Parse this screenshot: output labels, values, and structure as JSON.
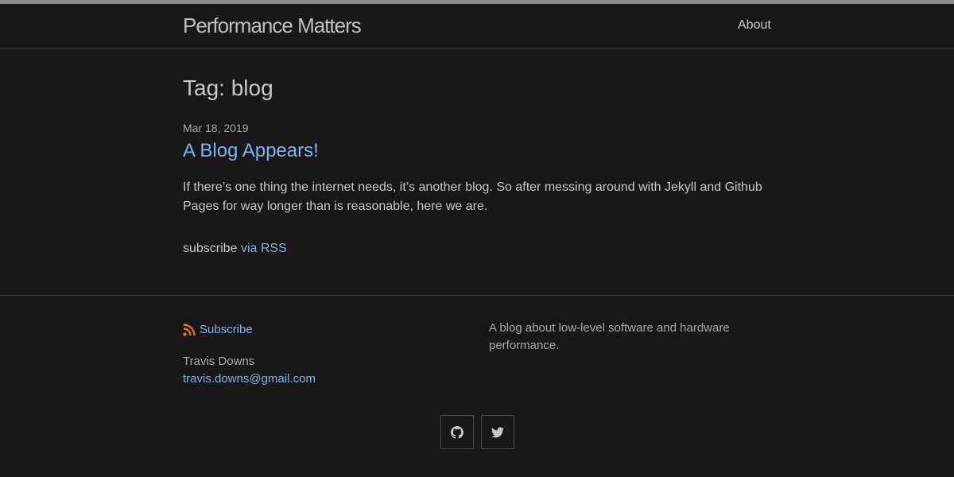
{
  "header": {
    "site_title": "Performance Matters",
    "nav": {
      "about_label": "About"
    }
  },
  "main": {
    "page_heading": "Tag: blog",
    "posts": [
      {
        "date": "Mar 18, 2019",
        "title": "A Blog Appears!",
        "excerpt": "If there’s one thing the internet needs, it’s another blog. So after messing around with Jekyll and Github Pages for way longer than is reasonable, here we are."
      }
    ],
    "rss": {
      "prefix": "subscribe",
      "link_label": "via RSS"
    }
  },
  "footer": {
    "subscribe_label": "Subscribe",
    "author_name": "Travis Downs",
    "author_email": "travis.downs@gmail.com",
    "description": "A blog about low-level software and hardware performance.",
    "social": [
      {
        "icon": "github-icon"
      },
      {
        "icon": "twitter-icon"
      }
    ]
  },
  "colors": {
    "background": "#181818",
    "text": "#c8c8c8",
    "muted_text": "#a8a8a8",
    "link": "#7fb2f0",
    "rss_orange": "#f26b21",
    "border": "#3a3a3a"
  }
}
